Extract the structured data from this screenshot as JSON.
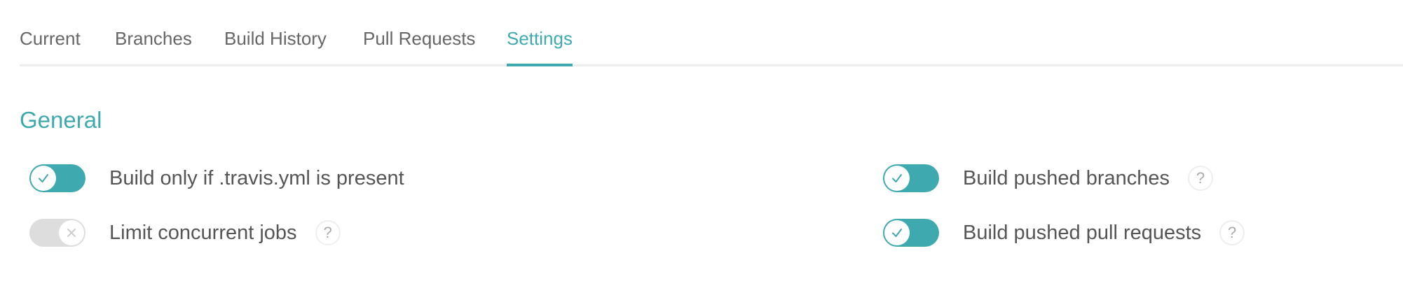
{
  "tabs": {
    "current": "Current",
    "branches": "Branches",
    "build_history": "Build History",
    "pull_requests": "Pull Requests",
    "settings": "Settings",
    "active": "Settings"
  },
  "general": {
    "title": "General",
    "settings": [
      {
        "label": "Build only if .travis.yml is present",
        "enabled": true,
        "has_help": false
      },
      {
        "label": "Build pushed branches",
        "enabled": true,
        "has_help": true
      },
      {
        "label": "Limit concurrent jobs",
        "enabled": false,
        "has_help": true
      },
      {
        "label": "Build pushed pull requests",
        "enabled": true,
        "has_help": true
      }
    ]
  },
  "help_glyph": "?",
  "icons": {
    "on": "check-icon",
    "off": "x-icon",
    "help": "help-icon"
  },
  "colors": {
    "accent": "#3eaaaf",
    "toggle_off": "#dddddd",
    "text": "#555555",
    "divider": "#eeeeee"
  }
}
